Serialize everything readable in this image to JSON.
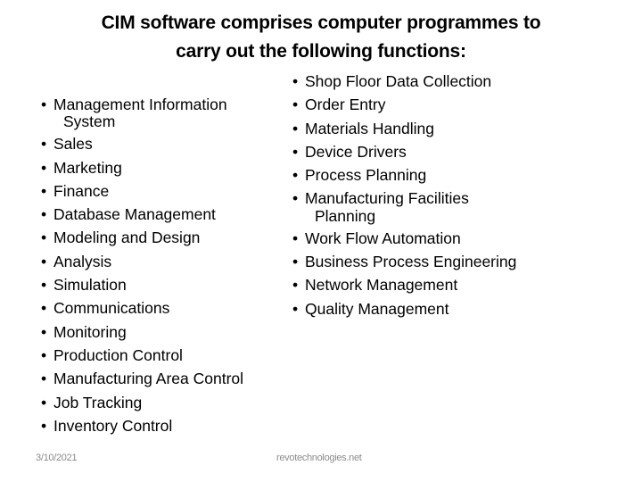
{
  "slide": {
    "title_line1": "CIM software comprises computer programmes to",
    "title_line2": "carry out the following functions:",
    "bullet_glyph": "•",
    "left_items": [
      {
        "label": "Management Information",
        "continuation": "System"
      },
      {
        "label": "Sales"
      },
      {
        "label": "Marketing"
      },
      {
        "label": "Finance"
      },
      {
        "label": "Database Management"
      },
      {
        "label": "Modeling and Design"
      },
      {
        "label": "Analysis"
      },
      {
        "label": "Simulation"
      },
      {
        "label": "Communications"
      },
      {
        "label": "Monitoring"
      },
      {
        "label": "Production Control"
      },
      {
        "label": "Manufacturing Area Control"
      },
      {
        "label": "Job Tracking"
      },
      {
        "label": "Inventory Control"
      }
    ],
    "right_items": [
      {
        "label": "Shop Floor Data Collection"
      },
      {
        "label": "Order Entry"
      },
      {
        "label": "Materials Handling"
      },
      {
        "label": "Device Drivers"
      },
      {
        "label": "Process Planning"
      },
      {
        "label": "Manufacturing Facilities",
        "continuation": "Planning"
      },
      {
        "label": "Work Flow Automation"
      },
      {
        "label": "Business Process Engineering"
      },
      {
        "label": "Network Management"
      },
      {
        "label": "Quality Management"
      }
    ]
  },
  "footer": {
    "date": "3/10/2021",
    "website": "revotechnologies.net"
  }
}
